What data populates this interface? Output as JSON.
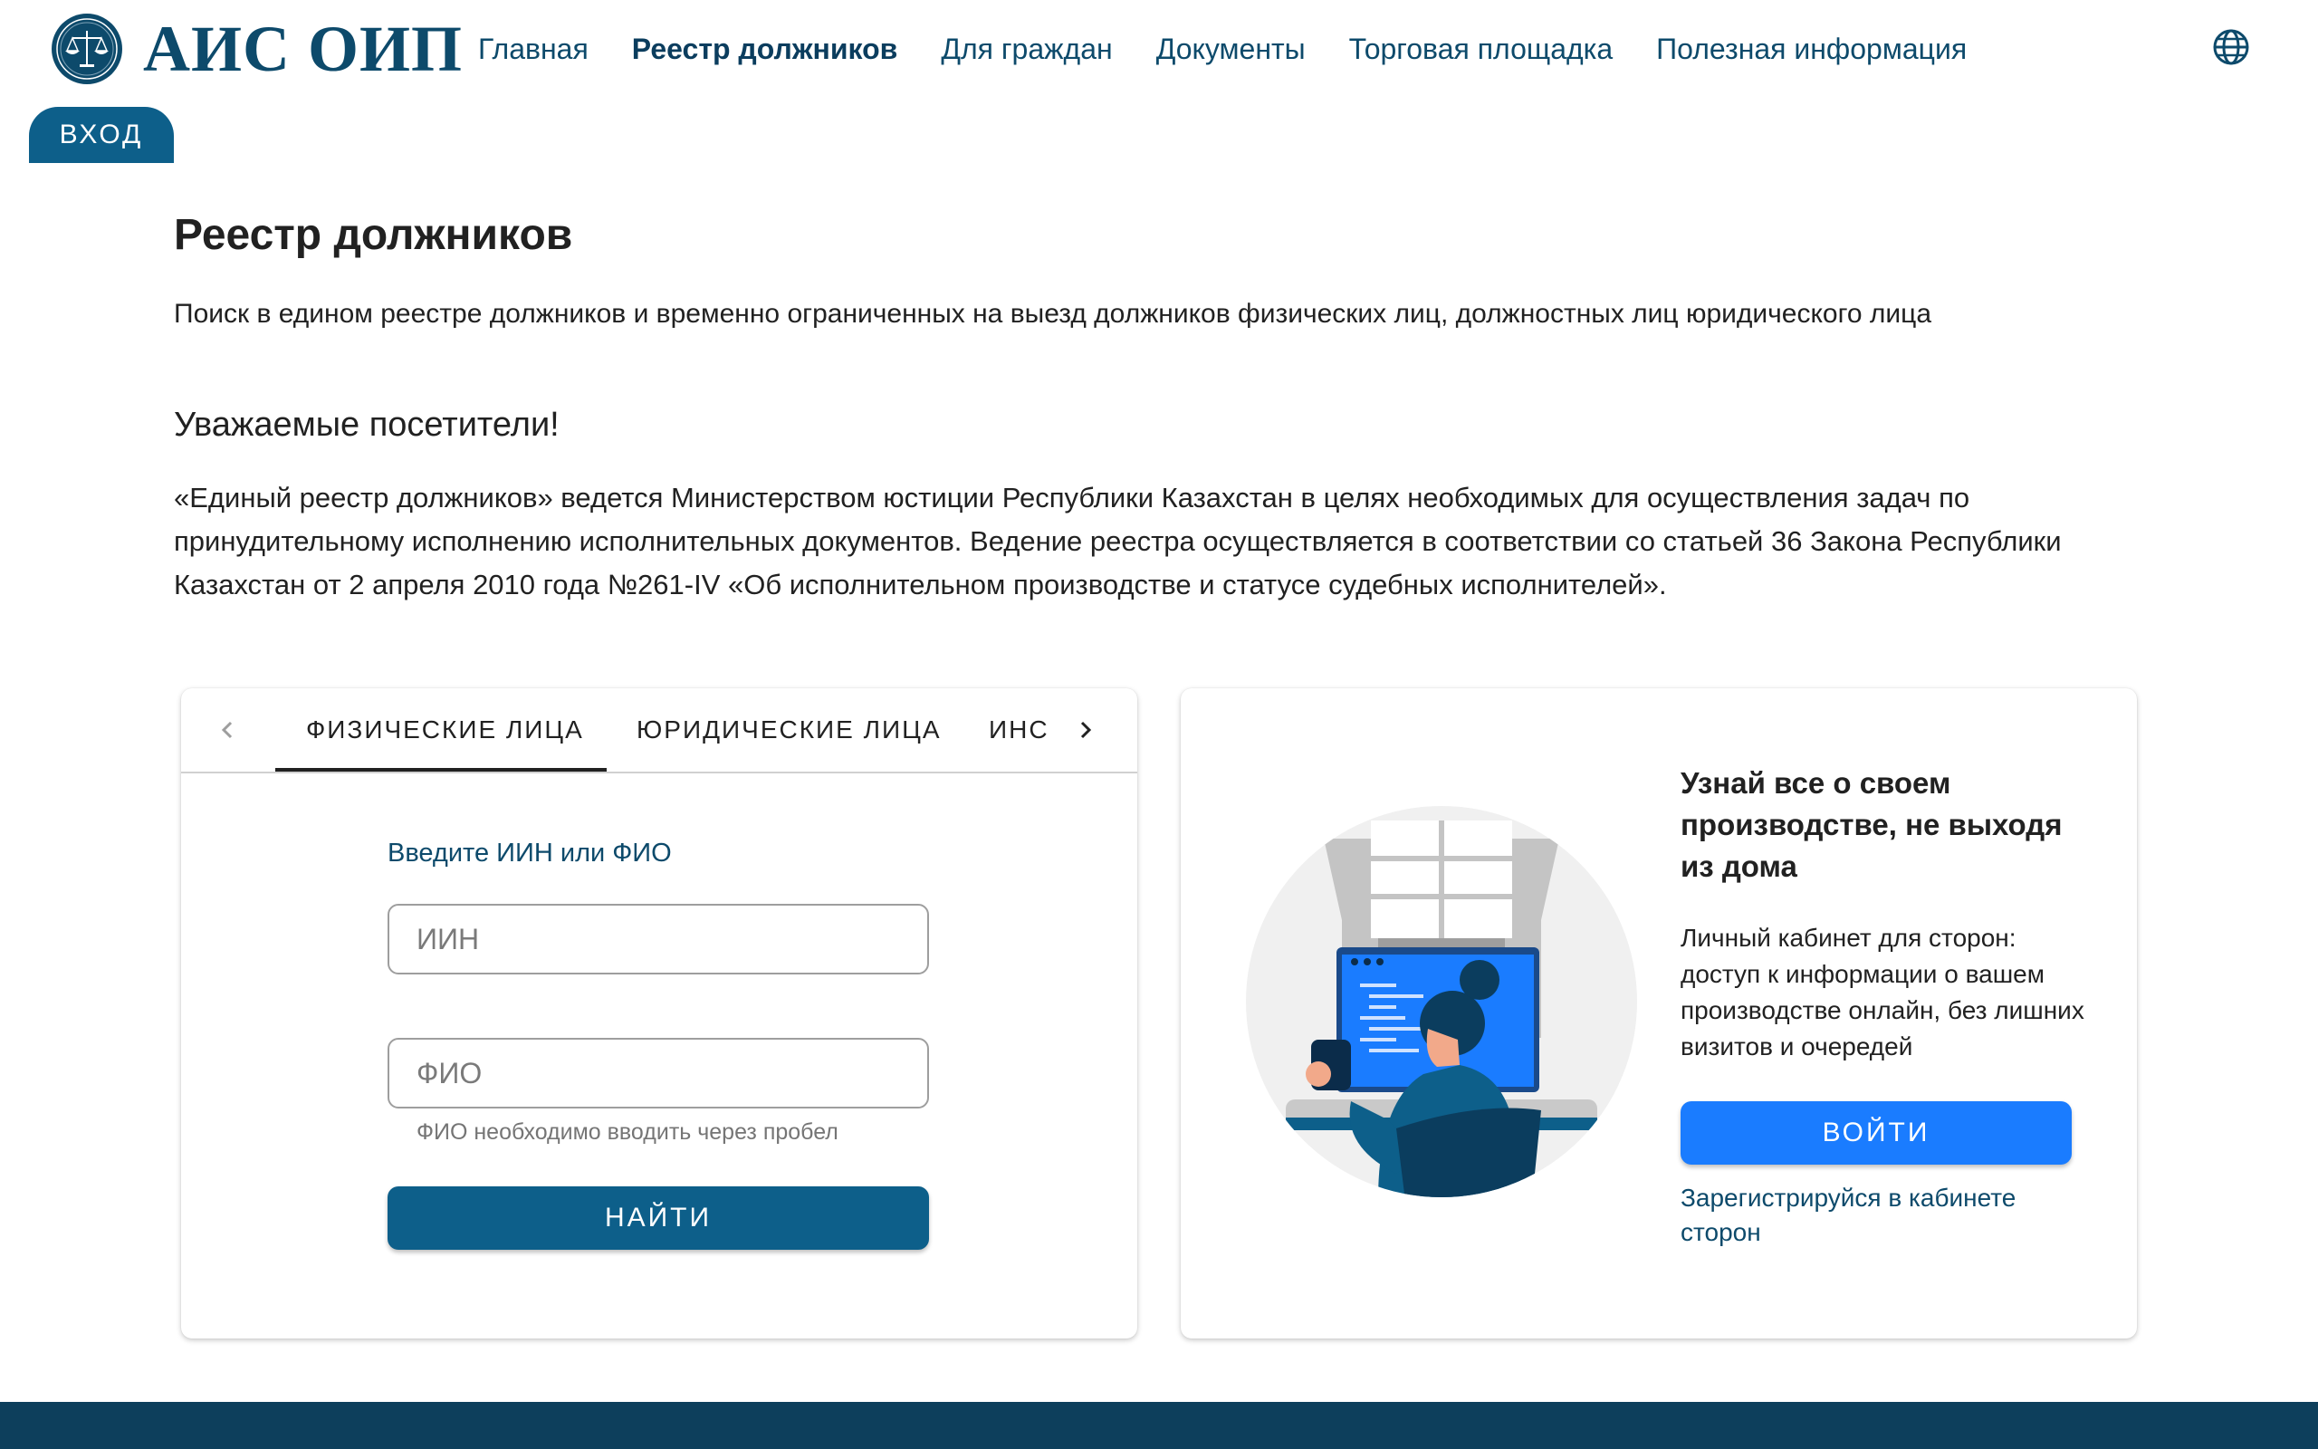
{
  "header": {
    "logo_text": "АИС ОИП",
    "icons": {
      "emblem": "scales-of-justice-emblem",
      "language": "globe-icon"
    },
    "nav": [
      {
        "label": "Главная",
        "active": false
      },
      {
        "label": "Реестр должников",
        "active": true
      },
      {
        "label": "Для граждан",
        "active": false
      },
      {
        "label": "Документы",
        "active": false
      },
      {
        "label": "Торговая площадка",
        "active": false
      },
      {
        "label": "Полезная информация",
        "active": false
      }
    ],
    "login_label": "ВХОД"
  },
  "main": {
    "title": "Реестр должников",
    "subtitle": "Поиск в едином реестре должников и временно ограниченных на выезд должников физических лиц, должностных лиц юридического лица",
    "greeting": "Уважаемые посетители!",
    "intro": "«Единый реестр должников» ведется Министерством юстиции Республики Казахстан в целях необходимых для осуществления задач по принудительному исполнению исполнительных документов. Ведение реестра осуществляется в соответствии со статьей 36 Закона Республики Казахстан от 2 апреля 2010 года №261-IV «Об исполнительном производстве и статусе судебных исполнителей»."
  },
  "search_card": {
    "tabs": [
      {
        "label": "ФИЗИЧЕСКИЕ ЛИЦА",
        "active": true
      },
      {
        "label": "ЮРИДИЧЕСКИЕ ЛИЦА",
        "active": false
      },
      {
        "label": "ИНС",
        "active": false
      }
    ],
    "form_label": "Введите ИИН или ФИО",
    "iin_placeholder": "ИИН",
    "iin_value": "",
    "fio_placeholder": "ФИО",
    "fio_value": "",
    "hint": "ФИО необходимо вводить через пробел",
    "submit_label": "НАЙТИ"
  },
  "promo_card": {
    "title": "Узнай все о своем производстве, не выходя из дома",
    "text": "Личный кабинет для сторон: доступ к информации о вашем производстве онлайн, без лишних визитов и очередей",
    "button_label": "ВОЙТИ",
    "register_link": "Зарегистрируйся в кабинете сторон"
  },
  "colors": {
    "brand": "#0d4a6b",
    "primary_button": "#0d5f8a",
    "accent_button": "#1a7cff",
    "footer": "#0d3f5c"
  }
}
